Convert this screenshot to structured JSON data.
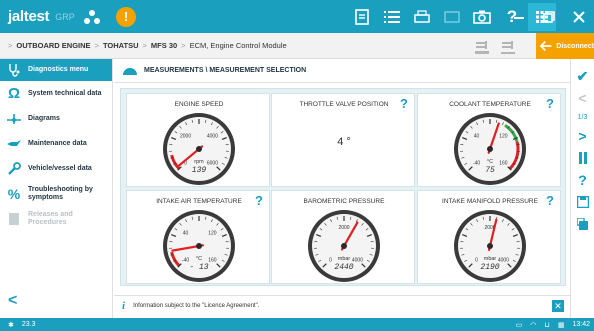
{
  "app": {
    "logo": "jaltest",
    "logo_sub": "GRP"
  },
  "breadcrumb": {
    "items": [
      "OUTBOARD ENGINE",
      "TOHATSU",
      "MFS 30",
      "ECM, Engine Control Module"
    ]
  },
  "actions": {
    "disconnect_label": "Disconnect"
  },
  "sidebar": {
    "items": [
      {
        "label": "Diagnostics menu",
        "icon": "stethoscope-icon"
      },
      {
        "label": "System technical data",
        "icon": "ohm-icon"
      },
      {
        "label": "Diagrams",
        "icon": "wiring-icon"
      },
      {
        "label": "Maintenance data",
        "icon": "oil-can-icon"
      },
      {
        "label": "Vehicle/vessel data",
        "icon": "wrench-icon"
      },
      {
        "label": "Troubleshooting by symptoms",
        "icon": "percent-tools-icon"
      },
      {
        "label": "Releases and Procedures",
        "icon": "document-icon"
      }
    ]
  },
  "main": {
    "header": "MEASUREMENTS \\ MEASUREMENT SELECTION",
    "info": "Information subject to the \"Licence Agreement\"."
  },
  "cards": [
    {
      "title": "ENGINE SPEED",
      "unit": "rpm",
      "value": "139",
      "help": false,
      "type": "gauge",
      "gauge": "rpm"
    },
    {
      "title": "THROTTLE VALVE POSITION",
      "value": "4 °",
      "help": true,
      "type": "text"
    },
    {
      "title": "COOLANT TEMPERATURE",
      "unit": "°C",
      "value": "75",
      "help": true,
      "type": "gauge",
      "gauge": "temp"
    },
    {
      "title": "INTAKE AIR TEMPERATURE",
      "unit": "°C",
      "value": "- 13",
      "help": true,
      "type": "gauge",
      "gauge": "temp2"
    },
    {
      "title": "BAROMETRIC PRESSURE",
      "unit": "mbar",
      "value": "2440",
      "help": false,
      "type": "gauge",
      "gauge": "press"
    },
    {
      "title": "INTAKE MANIFOLD PRESSURE",
      "unit": "mbar",
      "value": "2190",
      "help": true,
      "type": "gauge",
      "gauge": "press2"
    }
  ],
  "gauges": {
    "rpm": {
      "ticks": [
        "0",
        "2000",
        "4000",
        "6000"
      ],
      "level": 0.02,
      "zone": "red-low"
    },
    "temp": {
      "ticks": [
        "-40",
        "40",
        "120",
        "160"
      ],
      "level": 0.57,
      "zone": "red-high"
    },
    "temp2": {
      "ticks": [
        "-40",
        "40",
        "120",
        "160"
      ],
      "level": 0.13,
      "zone": "red-low"
    },
    "press": {
      "ticks": [
        "0",
        "2000",
        "4000"
      ],
      "level": 0.61,
      "zone": "none"
    },
    "press2": {
      "ticks": [
        "0",
        "2000",
        "4000"
      ],
      "level": 0.55,
      "zone": "none"
    }
  },
  "rail": {
    "page": "1/3"
  },
  "status": {
    "left_value": "23.3",
    "time": "13:42"
  },
  "colors": {
    "accent": "#1a9fbf",
    "warning": "#f5a200",
    "needle": "#e02020"
  }
}
